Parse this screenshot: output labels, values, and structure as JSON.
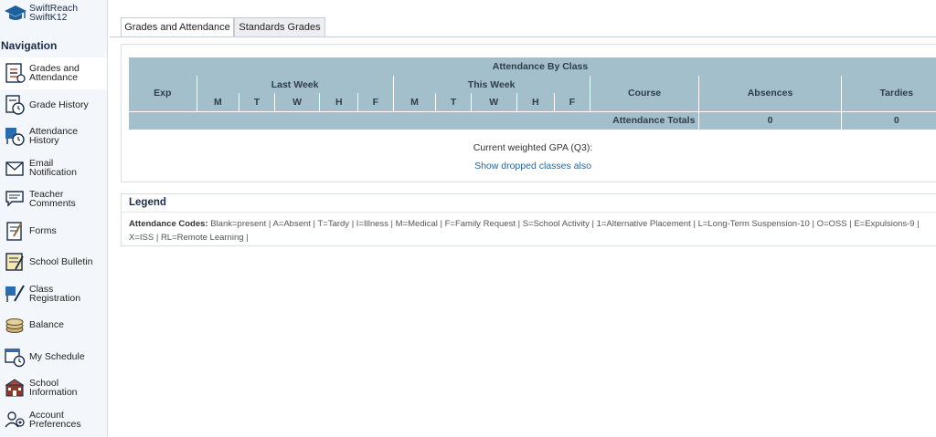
{
  "brand": {
    "line1": "SwiftReach",
    "line2": "SwiftK12"
  },
  "navigation": {
    "heading": "Navigation",
    "items": [
      {
        "line1": "Grades and",
        "line2": "Attendance",
        "icon": "grades-icon",
        "active": true
      },
      {
        "line1": "Grade History",
        "line2": "",
        "icon": "grade-history-icon"
      },
      {
        "line1": "Attendance",
        "line2": "History",
        "icon": "attendance-history-icon"
      },
      {
        "line1": "Email",
        "line2": "Notification",
        "icon": "email-icon"
      },
      {
        "line1": "Teacher",
        "line2": "Comments",
        "icon": "comments-icon"
      },
      {
        "line1": "Forms",
        "line2": "",
        "icon": "forms-icon"
      },
      {
        "line1": "School Bulletin",
        "line2": "",
        "icon": "bulletin-icon"
      },
      {
        "line1": "Class",
        "line2": "Registration",
        "icon": "class-registration-icon"
      },
      {
        "line1": "Balance",
        "line2": "",
        "icon": "balance-icon"
      },
      {
        "line1": "My Schedule",
        "line2": "",
        "icon": "schedule-icon"
      },
      {
        "line1": "School",
        "line2": "Information",
        "icon": "school-info-icon"
      },
      {
        "line1": "Account",
        "line2": "Preferences",
        "icon": "account-icon"
      }
    ]
  },
  "tabs": [
    {
      "label": "Grades and Attendance",
      "active": true
    },
    {
      "label": "Standards Grades",
      "active": false
    }
  ],
  "attendance": {
    "title": "Attendance By Class",
    "exp": "Exp",
    "last_week": "Last Week",
    "this_week": "This Week",
    "days": [
      "M",
      "T",
      "W",
      "H",
      "F"
    ],
    "course": "Course",
    "absences": "Absences",
    "tardies": "Tardies",
    "totals_label": "Attendance Totals",
    "totals_absences": "0",
    "totals_tardies": "0"
  },
  "gpa_text": "Current weighted GPA (Q3):",
  "dropped_link": "Show dropped classes also",
  "legend": {
    "title": "Legend",
    "codes_label": "Attendance Codes:",
    "codes_text": "Blank=present | A=Absent | T=Tardy | I=Illness | M=Medical | F=Family Request | S=School Activity | 1=Alternative Placement | L=Long-Term Suspension-10 | O=OSS | E=Expulsions-9 | X=ISS | RL=Remote Learning |"
  },
  "colors": {
    "table_header": "#a3bfcb",
    "link": "#2a6592",
    "sidebar_bg": "#f3f6fa"
  }
}
